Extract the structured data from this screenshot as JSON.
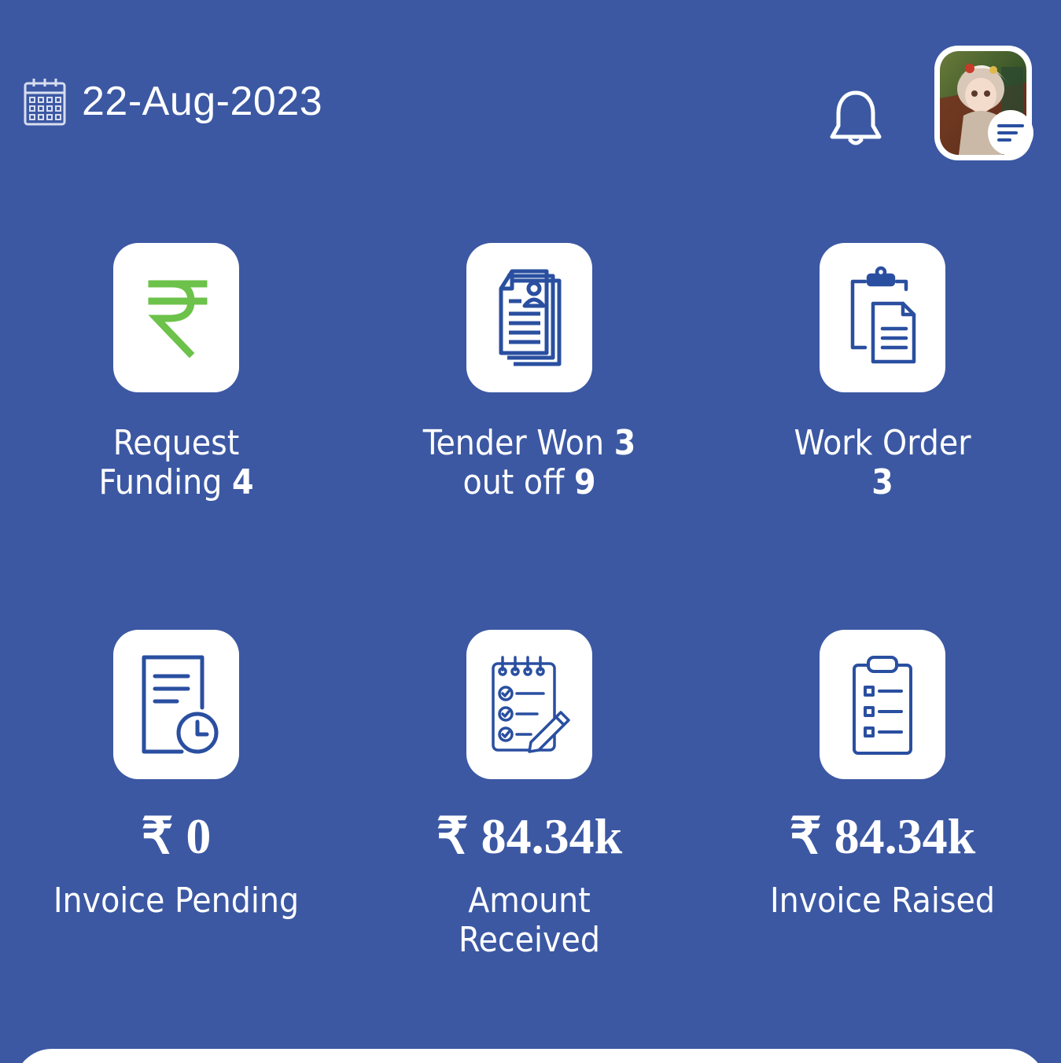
{
  "header": {
    "date": "22-Aug-2023",
    "calendar_icon": "calendar-icon",
    "notification_icon": "bell-icon",
    "menu_icon": "menu-lines-icon"
  },
  "colors": {
    "background": "#3c58a3",
    "card": "#ffffff",
    "icon_blue": "#2a4fa0",
    "rupee_green": "#6cc24a"
  },
  "tiles_row1": [
    {
      "icon": "rupee-icon",
      "label_text": "Request Funding",
      "label_line1": "Request",
      "label_line2": "Funding",
      "count": "4"
    },
    {
      "icon": "tender-document-icon",
      "label_text": "Tender Won",
      "label_mid": "out off",
      "won": "3",
      "total": "9"
    },
    {
      "icon": "work-order-clipboard-icon",
      "label_text": "Work Order",
      "count": "3"
    }
  ],
  "tiles_row2": [
    {
      "icon": "invoice-pending-clock-icon",
      "amount": "₹ 0",
      "label": "Invoice Pending"
    },
    {
      "icon": "checklist-pen-icon",
      "amount": "₹ 84.34k",
      "label_line1": "Amount",
      "label_line2": "Received"
    },
    {
      "icon": "clipboard-list-icon",
      "amount": "₹ 84.34k",
      "label": "Invoice Raised"
    }
  ]
}
